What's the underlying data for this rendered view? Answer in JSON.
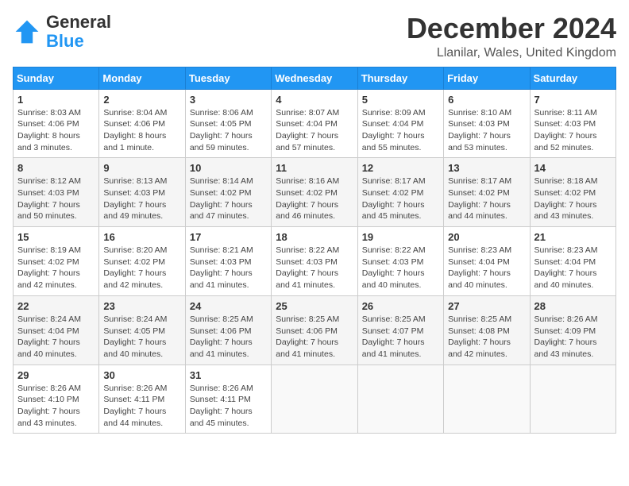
{
  "logo": {
    "general": "General",
    "blue": "Blue"
  },
  "header": {
    "title": "December 2024",
    "location": "Llanilar, Wales, United Kingdom"
  },
  "weekdays": [
    "Sunday",
    "Monday",
    "Tuesday",
    "Wednesday",
    "Thursday",
    "Friday",
    "Saturday"
  ],
  "weeks": [
    [
      {
        "day": "1",
        "sunrise": "Sunrise: 8:03 AM",
        "sunset": "Sunset: 4:06 PM",
        "daylight": "Daylight: 8 hours and 3 minutes."
      },
      {
        "day": "2",
        "sunrise": "Sunrise: 8:04 AM",
        "sunset": "Sunset: 4:06 PM",
        "daylight": "Daylight: 8 hours and 1 minute."
      },
      {
        "day": "3",
        "sunrise": "Sunrise: 8:06 AM",
        "sunset": "Sunset: 4:05 PM",
        "daylight": "Daylight: 7 hours and 59 minutes."
      },
      {
        "day": "4",
        "sunrise": "Sunrise: 8:07 AM",
        "sunset": "Sunset: 4:04 PM",
        "daylight": "Daylight: 7 hours and 57 minutes."
      },
      {
        "day": "5",
        "sunrise": "Sunrise: 8:09 AM",
        "sunset": "Sunset: 4:04 PM",
        "daylight": "Daylight: 7 hours and 55 minutes."
      },
      {
        "day": "6",
        "sunrise": "Sunrise: 8:10 AM",
        "sunset": "Sunset: 4:03 PM",
        "daylight": "Daylight: 7 hours and 53 minutes."
      },
      {
        "day": "7",
        "sunrise": "Sunrise: 8:11 AM",
        "sunset": "Sunset: 4:03 PM",
        "daylight": "Daylight: 7 hours and 52 minutes."
      }
    ],
    [
      {
        "day": "8",
        "sunrise": "Sunrise: 8:12 AM",
        "sunset": "Sunset: 4:03 PM",
        "daylight": "Daylight: 7 hours and 50 minutes."
      },
      {
        "day": "9",
        "sunrise": "Sunrise: 8:13 AM",
        "sunset": "Sunset: 4:03 PM",
        "daylight": "Daylight: 7 hours and 49 minutes."
      },
      {
        "day": "10",
        "sunrise": "Sunrise: 8:14 AM",
        "sunset": "Sunset: 4:02 PM",
        "daylight": "Daylight: 7 hours and 47 minutes."
      },
      {
        "day": "11",
        "sunrise": "Sunrise: 8:16 AM",
        "sunset": "Sunset: 4:02 PM",
        "daylight": "Daylight: 7 hours and 46 minutes."
      },
      {
        "day": "12",
        "sunrise": "Sunrise: 8:17 AM",
        "sunset": "Sunset: 4:02 PM",
        "daylight": "Daylight: 7 hours and 45 minutes."
      },
      {
        "day": "13",
        "sunrise": "Sunrise: 8:17 AM",
        "sunset": "Sunset: 4:02 PM",
        "daylight": "Daylight: 7 hours and 44 minutes."
      },
      {
        "day": "14",
        "sunrise": "Sunrise: 8:18 AM",
        "sunset": "Sunset: 4:02 PM",
        "daylight": "Daylight: 7 hours and 43 minutes."
      }
    ],
    [
      {
        "day": "15",
        "sunrise": "Sunrise: 8:19 AM",
        "sunset": "Sunset: 4:02 PM",
        "daylight": "Daylight: 7 hours and 42 minutes."
      },
      {
        "day": "16",
        "sunrise": "Sunrise: 8:20 AM",
        "sunset": "Sunset: 4:02 PM",
        "daylight": "Daylight: 7 hours and 42 minutes."
      },
      {
        "day": "17",
        "sunrise": "Sunrise: 8:21 AM",
        "sunset": "Sunset: 4:03 PM",
        "daylight": "Daylight: 7 hours and 41 minutes."
      },
      {
        "day": "18",
        "sunrise": "Sunrise: 8:22 AM",
        "sunset": "Sunset: 4:03 PM",
        "daylight": "Daylight: 7 hours and 41 minutes."
      },
      {
        "day": "19",
        "sunrise": "Sunrise: 8:22 AM",
        "sunset": "Sunset: 4:03 PM",
        "daylight": "Daylight: 7 hours and 40 minutes."
      },
      {
        "day": "20",
        "sunrise": "Sunrise: 8:23 AM",
        "sunset": "Sunset: 4:04 PM",
        "daylight": "Daylight: 7 hours and 40 minutes."
      },
      {
        "day": "21",
        "sunrise": "Sunrise: 8:23 AM",
        "sunset": "Sunset: 4:04 PM",
        "daylight": "Daylight: 7 hours and 40 minutes."
      }
    ],
    [
      {
        "day": "22",
        "sunrise": "Sunrise: 8:24 AM",
        "sunset": "Sunset: 4:04 PM",
        "daylight": "Daylight: 7 hours and 40 minutes."
      },
      {
        "day": "23",
        "sunrise": "Sunrise: 8:24 AM",
        "sunset": "Sunset: 4:05 PM",
        "daylight": "Daylight: 7 hours and 40 minutes."
      },
      {
        "day": "24",
        "sunrise": "Sunrise: 8:25 AM",
        "sunset": "Sunset: 4:06 PM",
        "daylight": "Daylight: 7 hours and 41 minutes."
      },
      {
        "day": "25",
        "sunrise": "Sunrise: 8:25 AM",
        "sunset": "Sunset: 4:06 PM",
        "daylight": "Daylight: 7 hours and 41 minutes."
      },
      {
        "day": "26",
        "sunrise": "Sunrise: 8:25 AM",
        "sunset": "Sunset: 4:07 PM",
        "daylight": "Daylight: 7 hours and 41 minutes."
      },
      {
        "day": "27",
        "sunrise": "Sunrise: 8:25 AM",
        "sunset": "Sunset: 4:08 PM",
        "daylight": "Daylight: 7 hours and 42 minutes."
      },
      {
        "day": "28",
        "sunrise": "Sunrise: 8:26 AM",
        "sunset": "Sunset: 4:09 PM",
        "daylight": "Daylight: 7 hours and 43 minutes."
      }
    ],
    [
      {
        "day": "29",
        "sunrise": "Sunrise: 8:26 AM",
        "sunset": "Sunset: 4:10 PM",
        "daylight": "Daylight: 7 hours and 43 minutes."
      },
      {
        "day": "30",
        "sunrise": "Sunrise: 8:26 AM",
        "sunset": "Sunset: 4:11 PM",
        "daylight": "Daylight: 7 hours and 44 minutes."
      },
      {
        "day": "31",
        "sunrise": "Sunrise: 8:26 AM",
        "sunset": "Sunset: 4:11 PM",
        "daylight": "Daylight: 7 hours and 45 minutes."
      },
      null,
      null,
      null,
      null
    ]
  ]
}
